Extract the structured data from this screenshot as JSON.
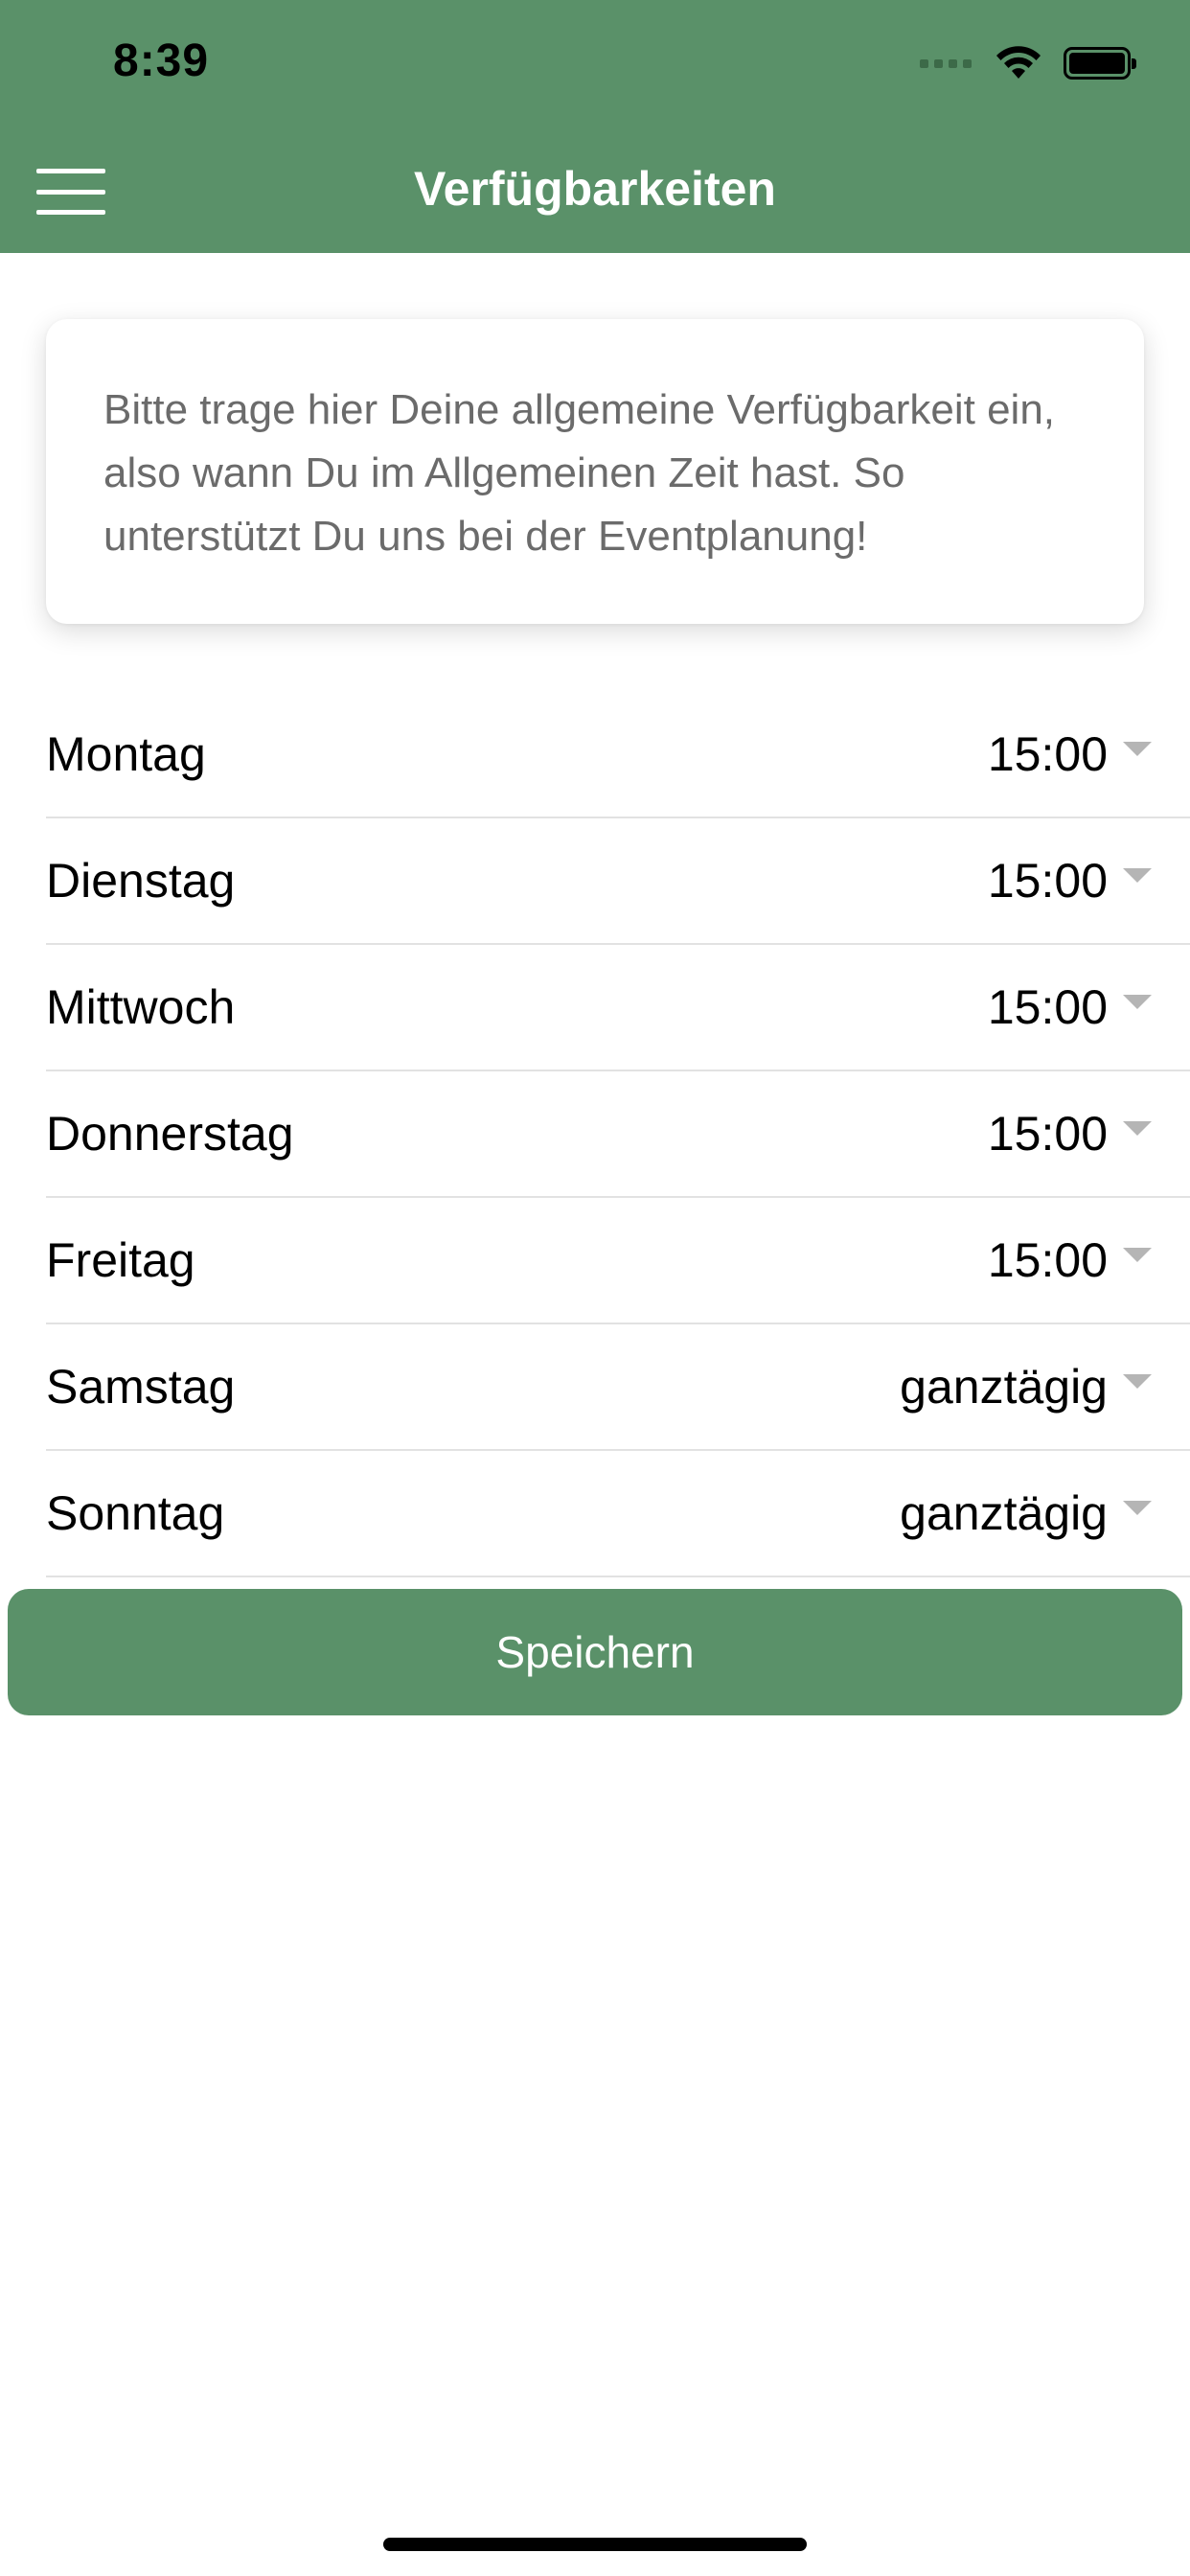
{
  "status_bar": {
    "time": "8:39"
  },
  "nav": {
    "title": "Verfügbarkeiten"
  },
  "info": {
    "text": "Bitte trage hier Deine allgemeine Verfügbarkeit ein, also wann Du im Allgemeinen Zeit hast. So unterstützt Du uns bei der Eventplanung!"
  },
  "days": [
    {
      "label": "Montag",
      "value": "15:00"
    },
    {
      "label": "Dienstag",
      "value": "15:00"
    },
    {
      "label": "Mittwoch",
      "value": "15:00"
    },
    {
      "label": "Donnerstag",
      "value": "15:00"
    },
    {
      "label": "Freitag",
      "value": "15:00"
    },
    {
      "label": "Samstag",
      "value": "ganztägig"
    },
    {
      "label": "Sonntag",
      "value": "ganztägig"
    }
  ],
  "actions": {
    "save_label": "Speichern"
  },
  "colors": {
    "accent": "#5a9169",
    "info_text": "#6b6b6b",
    "divider": "#e2e2e2"
  },
  "icons": {
    "menu": "hamburger-icon",
    "dropdown": "chevron-down-icon"
  }
}
